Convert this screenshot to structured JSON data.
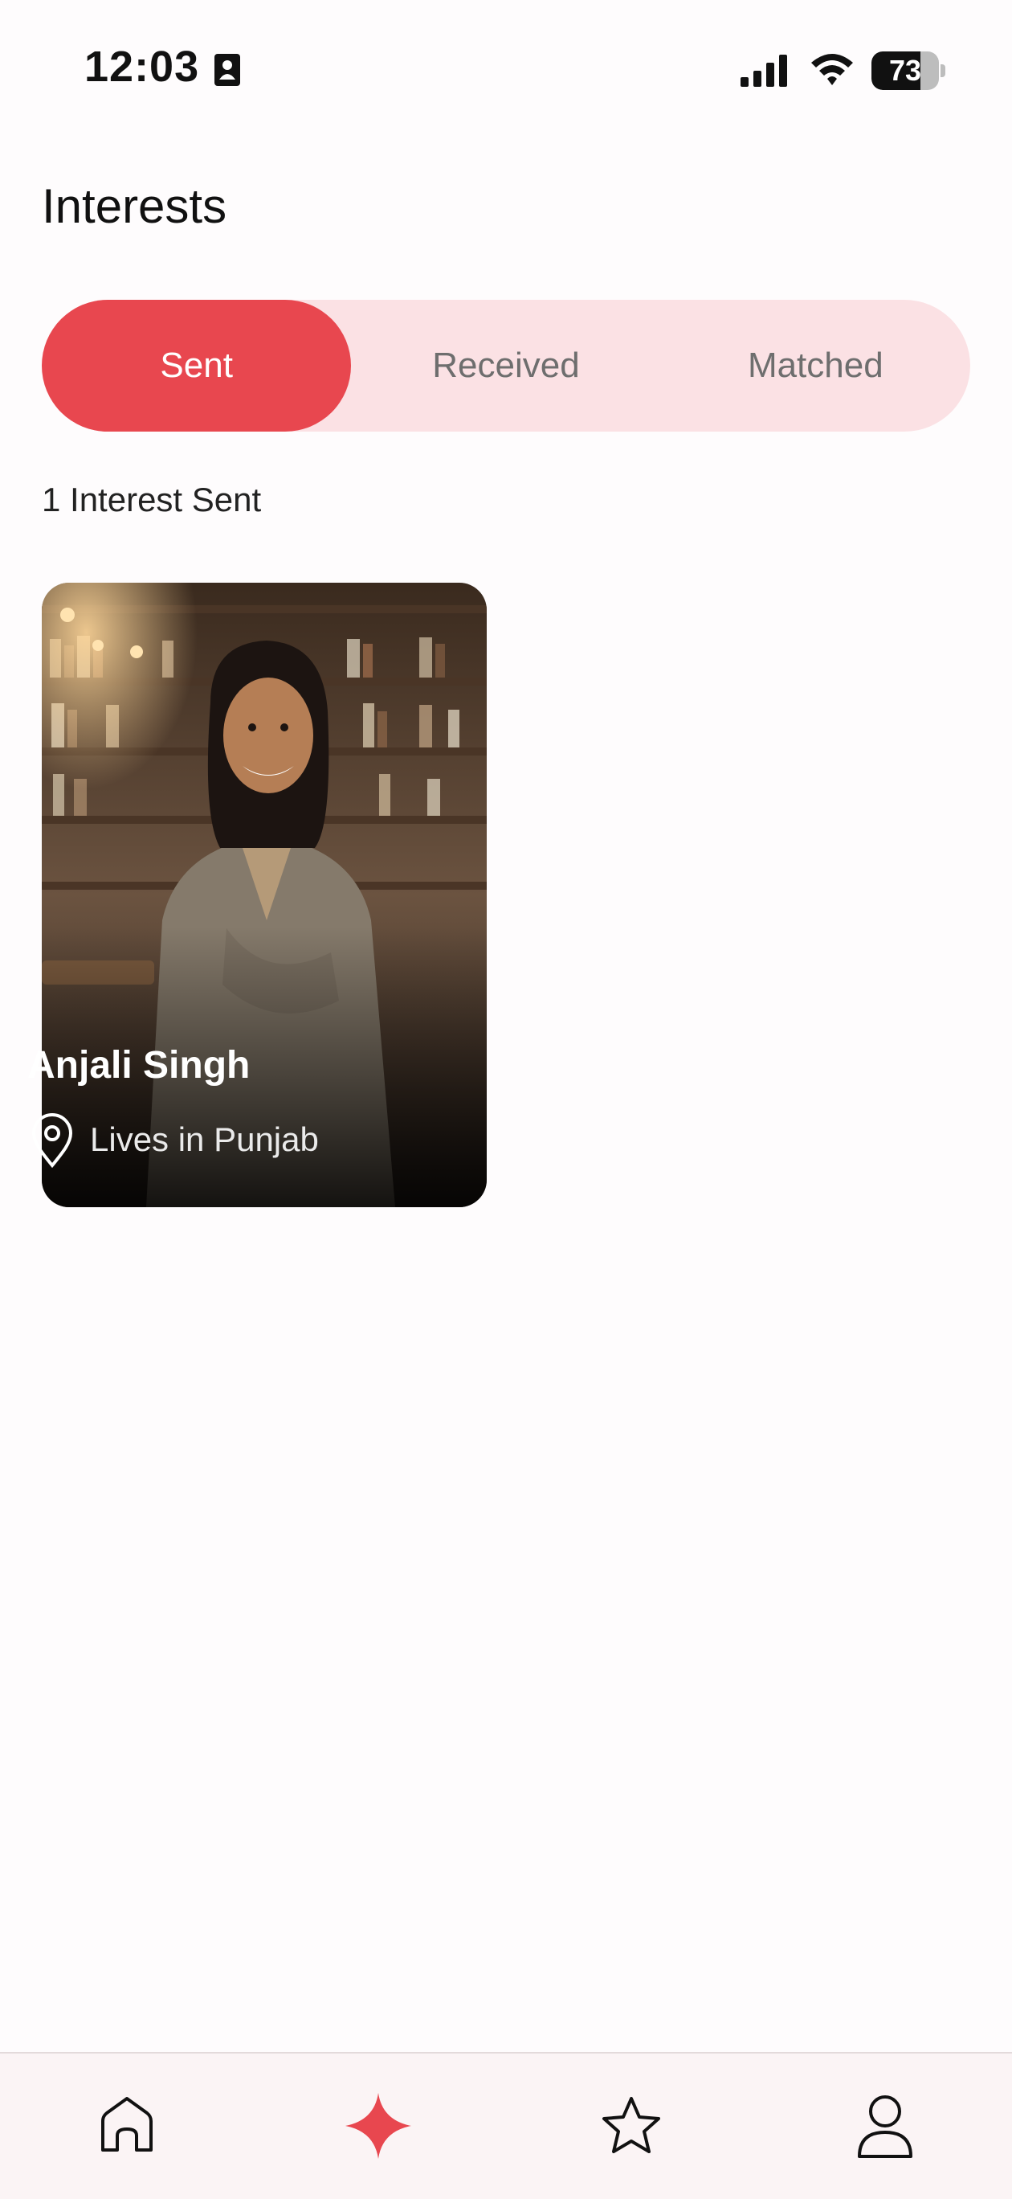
{
  "status_bar": {
    "time": "12:03",
    "battery_level": "73",
    "battery_fraction": 0.73
  },
  "header": {
    "title": "Interests"
  },
  "tabs": [
    {
      "label": "Sent",
      "active": true
    },
    {
      "label": "Received",
      "active": false
    },
    {
      "label": "Matched",
      "active": false
    }
  ],
  "summary": {
    "count_label": "1 Interest Sent"
  },
  "profiles": [
    {
      "name": "Anjali Singh",
      "location": "Lives in Punjab"
    }
  ],
  "bottom_nav": {
    "items": [
      {
        "icon": "home-icon",
        "active": false
      },
      {
        "icon": "sparkle-icon",
        "active": true
      },
      {
        "icon": "star-icon",
        "active": false
      },
      {
        "icon": "user-icon",
        "active": false
      }
    ]
  },
  "colors": {
    "accent": "#e8474f",
    "segment_bg": "#fbe1e4",
    "inactive_text": "#6e6e6e",
    "nav_bg": "#fbf4f5"
  }
}
